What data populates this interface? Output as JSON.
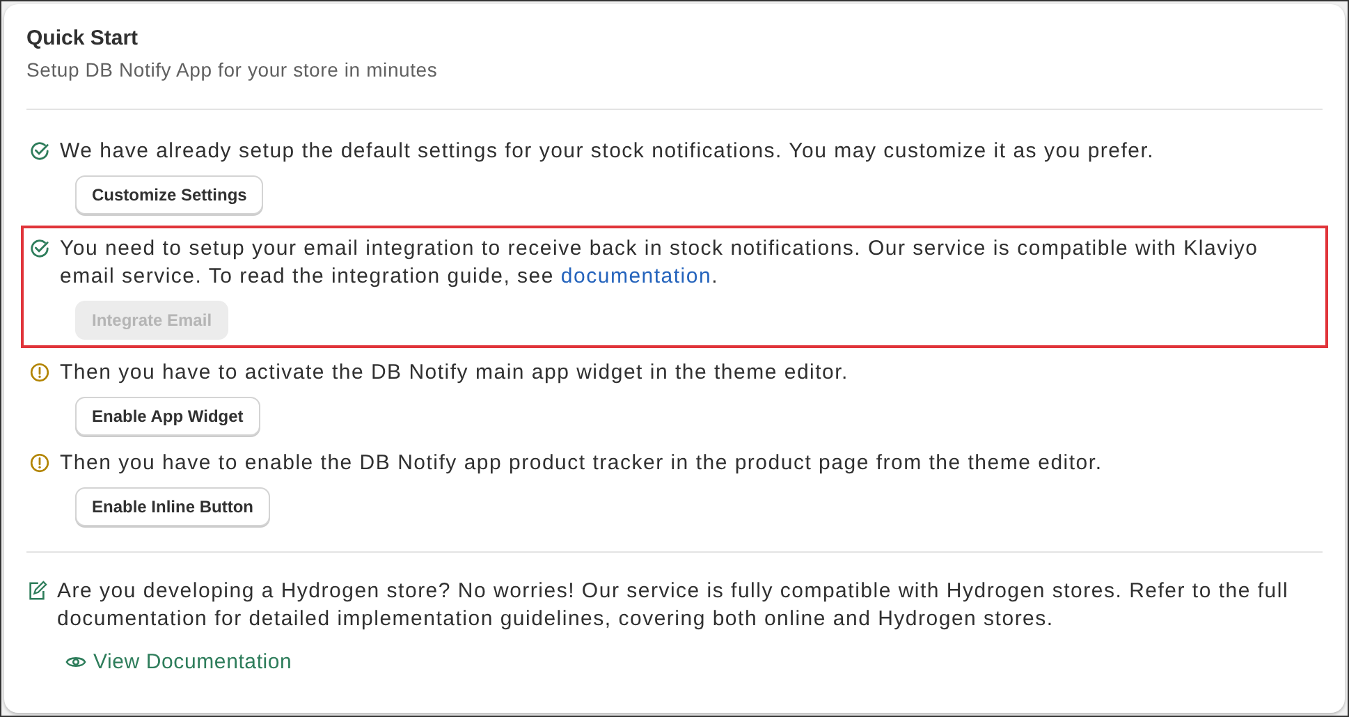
{
  "card": {
    "title": "Quick Start",
    "subtitle": "Setup DB Notify App for your store in minutes"
  },
  "steps": [
    {
      "kind": "done",
      "highlighted": false,
      "text": "We have already setup the default settings for your stock notifications. You may customize it as you prefer.",
      "button": {
        "label": "Customize Settings",
        "disabled": false
      }
    },
    {
      "kind": "done",
      "highlighted": true,
      "text": "You need to setup your email integration to receive back in stock notifications. Our service is compatible with Klaviyo email service. To read the integration guide, see ",
      "link": "documentation",
      "text_after": ".",
      "button": {
        "label": "Integrate Email",
        "disabled": true
      }
    },
    {
      "kind": "pending",
      "highlighted": false,
      "text": "Then you have to activate the DB Notify main app widget in the theme editor.",
      "button": {
        "label": "Enable App Widget",
        "disabled": false
      }
    },
    {
      "kind": "pending",
      "highlighted": false,
      "text": "Then you have to enable the DB Notify app product tracker in the product page from the theme editor.",
      "button": {
        "label": "Enable Inline Button",
        "disabled": false
      }
    }
  ],
  "hydrogen": {
    "text": "Are you developing a Hydrogen store? No worries! Our service is fully compatible with Hydrogen stores. Refer to the full documentation for detailed implementation guidelines, covering both online and Hydrogen stores.",
    "link": "View Documentation"
  }
}
